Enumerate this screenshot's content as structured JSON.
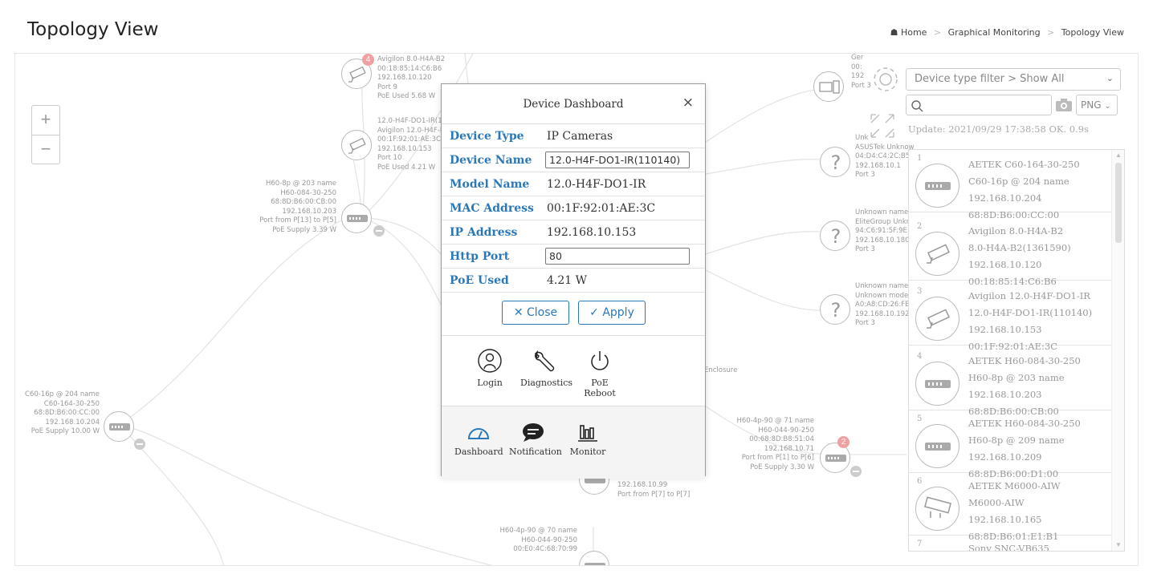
{
  "page": {
    "title": "Topology View",
    "breadcrumb": [
      "Home",
      "Graphical Monitoring",
      "Topology View"
    ]
  },
  "zoom": {
    "in": "+",
    "out": "−"
  },
  "topology_labels": {
    "cam1": [
      "Avigilon 8.0-H4A-B2",
      "00:18:85:14:C6:B6",
      "192.168.10.120",
      "Port 9",
      "PoE Used 5.68 W"
    ],
    "cam1_badge": "4",
    "cam2": [
      "12.0-H4F-DO1-IR(11",
      "Avigilon 12.0-H4F-DO",
      "00:1F:92:01:AE:3C",
      "192.168.10.153",
      "Port 10",
      "PoE Used 4.21 W"
    ],
    "sw_h60": [
      "H60-8p @ 203 name",
      "H60-084-30-250",
      "68:8D:B6:00:CB:00",
      "192.168.10.203",
      "Port from P[13] to P[5]",
      "PoE Supply 3.39 W"
    ],
    "sw_c60": [
      "C60-16p @ 204 name",
      "C60-164-30-250",
      "68:8D:B6:00:CC:00",
      "192.168.10.204",
      "PoE Supply 10.00 W"
    ],
    "unknown1": [
      "Unk",
      "ASUSTek Unknow",
      "04:D4:C4:2C:B5:E",
      "192.168.10.1",
      "Port 3"
    ],
    "unknown2": [
      "Unknown name",
      "EliteGroup Unknow",
      "94:C6:91:5F:9E:E",
      "192.168.10.180",
      "Port 3"
    ],
    "unknown3": [
      "Unknown name",
      "Unknown model",
      "A0:A8:CD:26:FE:F",
      "192.168.10.192",
      "Port 3"
    ],
    "pc_top": [
      "Ger",
      "00:",
      "192",
      "Port 3"
    ],
    "sw_h60_4p": [
      "H60-4p-90 @ 71 name",
      "H60-044-90-250",
      "00:68:8D:B8:51:04",
      "192.168.10.71",
      "Port from P[1] to P[6]",
      "PoE Supply 3.30 W"
    ],
    "sw_h60_4p_badge": "2",
    "sw_mid": [
      "192.168.10.99",
      "Port from P[7] to P[7]"
    ],
    "sw_bottom": [
      "H60-4p-90 @ 70 name",
      "H60-044-90-250",
      "00:E0:4C:68:70:99"
    ],
    "enclosure": "Enclosure"
  },
  "right_panel": {
    "filter_value": "Device type filter > Show All",
    "search_placeholder": "",
    "export_format": "PNG",
    "update_text": "Update: 2021/09/29 17:38:58 OK. 0.9s",
    "devices": [
      {
        "index": "1",
        "type": "switch",
        "lines": [
          "AETEK C60-164-30-250",
          "C60-16p @ 204 name",
          "192.168.10.204",
          "68:8D:B6:00:CC:00"
        ]
      },
      {
        "index": "2",
        "type": "camera",
        "lines": [
          "Avigilon 8.0-H4A-B2",
          "8.0-H4A-B2(1361590)",
          "192.168.10.120",
          "00:18:85:14:C6:B6"
        ]
      },
      {
        "index": "3",
        "type": "camera",
        "lines": [
          "Avigilon 12.0-H4F-DO1-IR",
          "12.0-H4F-DO1-IR(110140)",
          "192.168.10.153",
          "00:1F:92:01:AE:3C"
        ]
      },
      {
        "index": "4",
        "type": "switch",
        "lines": [
          "AETEK H60-084-30-250",
          "H60-8p @ 203 name",
          "192.168.10.203",
          "68:8D:B6:00:CB:00"
        ]
      },
      {
        "index": "5",
        "type": "switch",
        "lines": [
          "AETEK H60-084-30-250",
          "H60-8p @ 209 name",
          "192.168.10.209",
          "68:8D:B6:00:D1:00"
        ]
      },
      {
        "index": "6",
        "type": "camera",
        "lines": [
          "AETEK M6000-AIW",
          "M6000-AIW",
          "192.168.10.165",
          "68:8D:B6:01:E1:B1"
        ]
      },
      {
        "index": "7",
        "type": "camera",
        "lines": [
          "Sony SNC-VB635",
          "",
          "",
          ""
        ]
      }
    ]
  },
  "modal": {
    "title": "Device Dashboard",
    "close_symbol": "×",
    "fields": {
      "device_type_label": "Device Type",
      "device_type_value": "IP Cameras",
      "device_name_label": "Device Name",
      "device_name_value": "12.0-H4F-DO1-IR(110140)",
      "model_name_label": "Model Name",
      "model_name_value": "12.0-H4F-DO1-IR",
      "mac_label": "MAC Address",
      "mac_value": "00:1F:92:01:AE:3C",
      "ip_label": "IP Address",
      "ip_value": "192.168.10.153",
      "http_port_label": "Http Port",
      "http_port_value": "80",
      "poe_label": "PoE Used",
      "poe_value": "4.21 W"
    },
    "close_button": "Close",
    "apply_button": "Apply",
    "actions": {
      "login": "Login",
      "diagnostics": "Diagnostics",
      "poe_reboot": "PoE Reboot"
    },
    "tabs": {
      "dashboard": "Dashboard",
      "notification": "Notification",
      "monitor": "Monitor"
    }
  },
  "colors": {
    "accent": "#2b78b8",
    "badge": "#f0a0a0",
    "muted_text": "#999999"
  }
}
